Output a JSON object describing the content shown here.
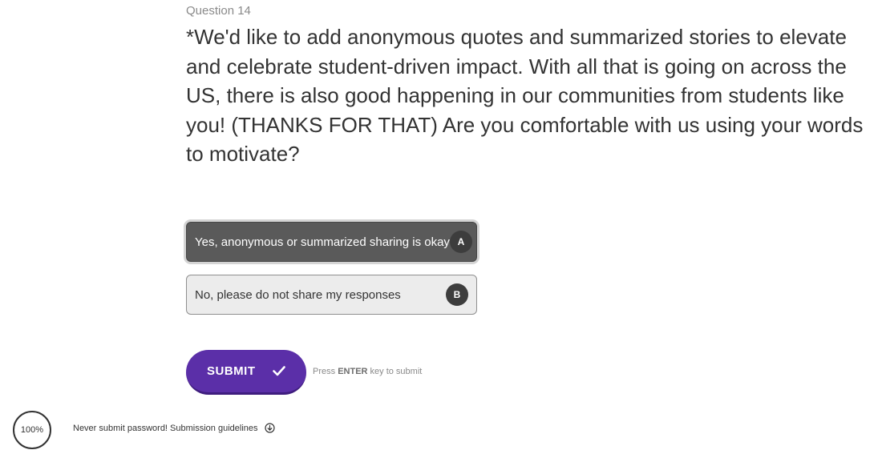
{
  "question": {
    "number_label": "Question 14",
    "text": "*We'd like to add anonymous quotes and summarized stories to elevate and celebrate student-driven impact. With all that is going on across the US, there is also good happening in our communities from students like you! (THANKS FOR THAT) Are you comfortable with us using your words to motivate?"
  },
  "choices": [
    {
      "label": "Yes, anonymous or summarized sharing is okay",
      "key": "A",
      "selected": true
    },
    {
      "label": "No, please do not share my responses",
      "key": "B",
      "selected": false
    }
  ],
  "submit": {
    "label": "SUBMIT",
    "hint_prefix": "Press",
    "hint_key": "ENTER",
    "hint_suffix": "key to submit"
  },
  "progress": {
    "label": "100%",
    "value": 1.0
  },
  "footer": {
    "note": "Never submit password! Submission guidelines"
  },
  "colors": {
    "accent": "#5b2fa8",
    "selected_choice_bg": "#5a5a5a",
    "choice_bg": "#ececec",
    "badge_bg": "#3d3d3d"
  },
  "icons": {
    "submit": "check-icon",
    "footer": "circle-arrow-down-icon"
  }
}
